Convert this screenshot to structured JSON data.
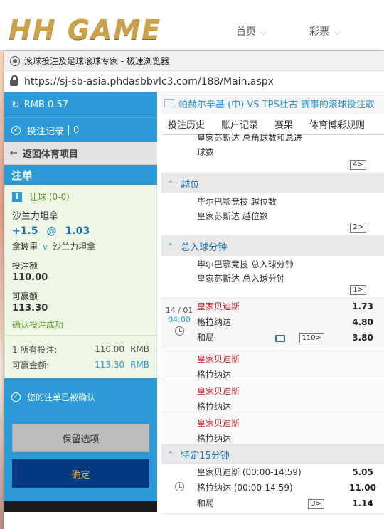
{
  "site": {
    "logo": "HH GAME",
    "nav": [
      {
        "label": "首页",
        "chev": "⌵"
      },
      {
        "label": "彩票",
        "chev": "⌵"
      }
    ]
  },
  "browser": {
    "title": "滚球投注及足球滚球专家 - 极速浏览器",
    "url": "https://sj-sb-asia.phdasbbvlc3.com/188/Main.aspx"
  },
  "left": {
    "balance": "RMB 0.57",
    "bet_record_label": "投注记录",
    "bet_record_count": "0",
    "back_label": "返回体育项目",
    "slip_title": "注单",
    "bet_type": "让球 (0-0)",
    "selection": "沙兰力坦拿",
    "handicap": "+1.5",
    "at": "@",
    "price": "1.03",
    "home": "拿玻里",
    "vs": "v",
    "away": "沙兰力坦拿",
    "stake_label": "投注额",
    "stake_value": "110.00",
    "win_label": "可赢额",
    "win_value": "113.30",
    "success_msg": "确认投注成功",
    "summary": {
      "all_bets_label": "1 所有投注:",
      "all_bets_amount": "110.00",
      "all_bets_currency": "RMB",
      "win_label": "可赢金额:",
      "win_amount": "113.30",
      "win_currency": "RMB"
    },
    "confirmed_msg": "您的注单已被确认",
    "keep_btn": "保留选项",
    "ok_btn": "确定"
  },
  "right": {
    "marquee": "帕赫尔辛基 (中) VS TPS杜古 赛事的滚球投注取",
    "tabs": [
      "投注历史",
      "账户记录",
      "赛果",
      "体育博彩规则"
    ],
    "top_market": {
      "lines": [
        "皇家苏斯达 总角球数和总进",
        "球数"
      ],
      "badge": "4>"
    },
    "sections": [
      {
        "title": "越位",
        "lines": [
          "毕尔巴鄂竞技 越位数",
          "皇家苏斯达 越位数"
        ],
        "badge": "2>"
      },
      {
        "title": "总入球分钟",
        "lines": [
          "毕尔巴鄂竞技 总入球分钟",
          "皇家苏斯达 总入球分钟"
        ],
        "badge": "1>"
      }
    ],
    "event": {
      "date": "14 / 01",
      "time": "04:00",
      "home": "皇家贝迪斯",
      "away": "格拉纳达",
      "draw": "和局",
      "odds": [
        "1.73",
        "4.80",
        "3.80"
      ],
      "badge": "110>"
    },
    "sub_events": [
      {
        "home": "皇家贝迪斯",
        "away": "格拉纳达"
      },
      {
        "home": "皇家贝迪斯",
        "away": "格拉纳达"
      },
      {
        "home": "皇家贝迪斯",
        "away": "格拉纳达"
      }
    ],
    "special": {
      "title": "特定15分钟",
      "home": "皇家贝迪斯 (00:00-14:59)",
      "away": "格拉纳达 (00:00-14:59)",
      "draw": "和局",
      "odds": [
        "5.05",
        "11.00",
        "1.14"
      ],
      "badge": "3>"
    }
  }
}
